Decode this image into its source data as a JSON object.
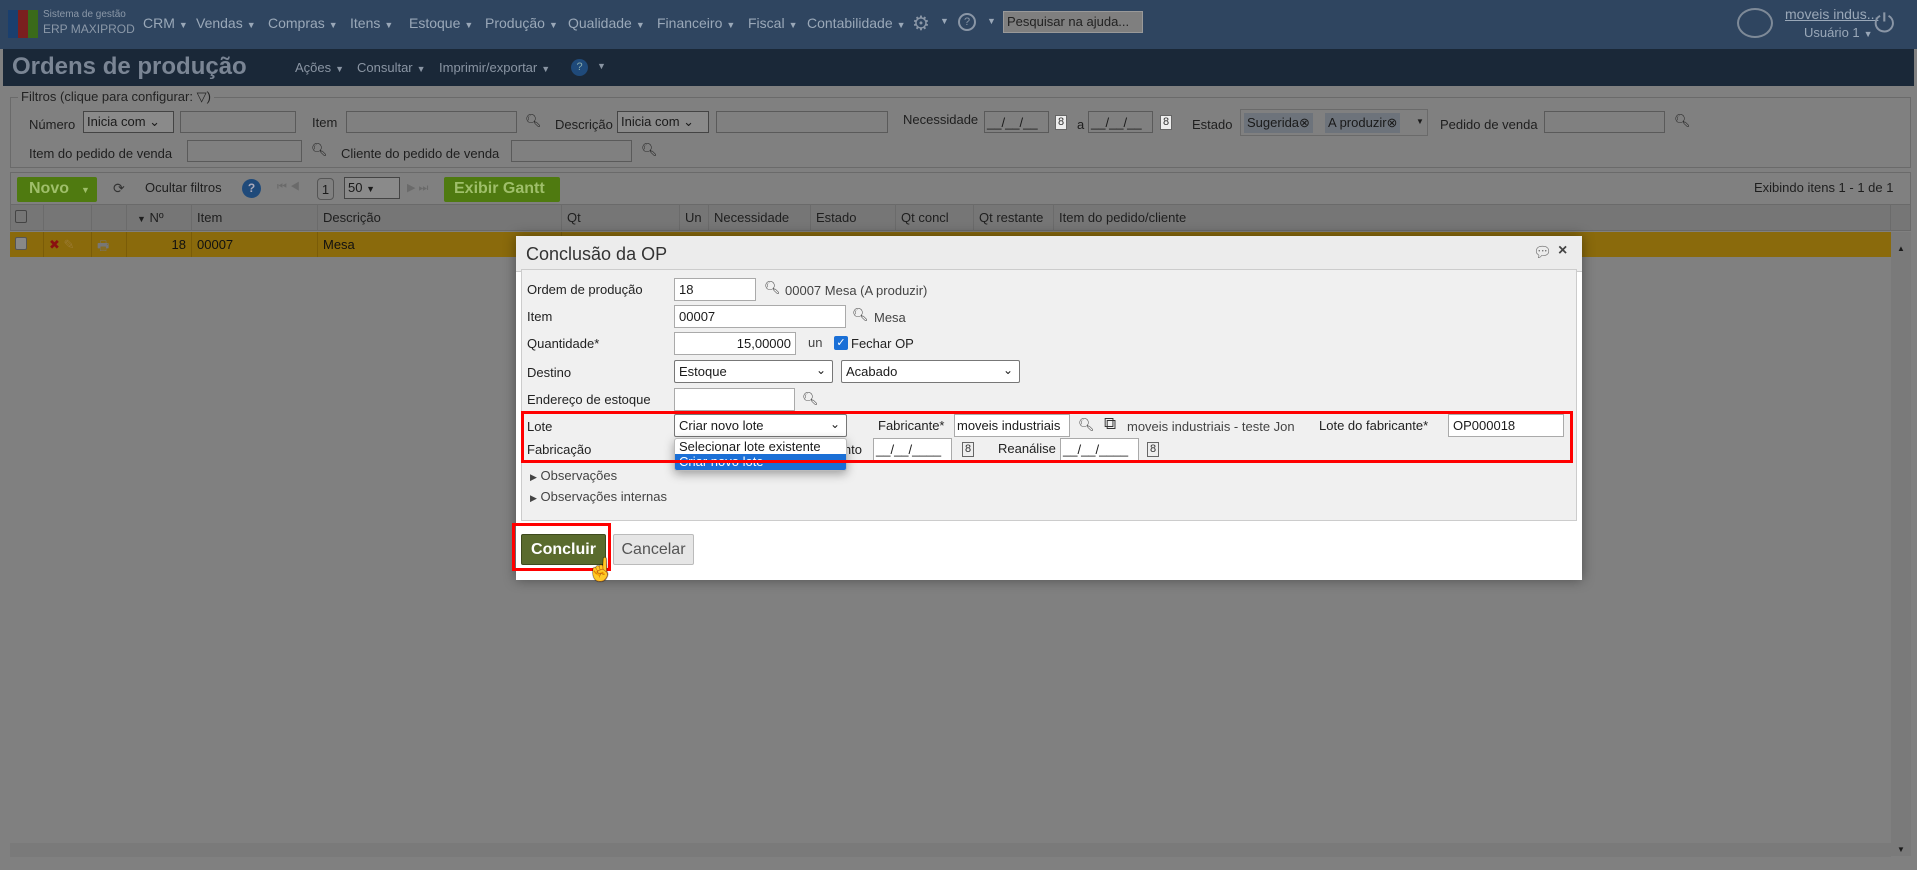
{
  "nav": {
    "logo_line1": "Sistema de gestão",
    "logo_line2": "ERP MAXIPROD",
    "menu": [
      "CRM",
      "Vendas",
      "Compras",
      "Itens",
      "Estoque",
      "Produção",
      "Qualidade",
      "Financeiro",
      "Fiscal",
      "Contabilidade"
    ],
    "search_placeholder": "Pesquisar na ajuda...",
    "company": "moveis indus...",
    "user": "Usuário 1"
  },
  "page": {
    "title": "Ordens de produção",
    "menu": [
      "Ações",
      "Consultar",
      "Imprimir/exportar"
    ]
  },
  "filters": {
    "legend": "Filtros (clique para configurar:",
    "numero": "Número",
    "numero_op": "Inicia com",
    "item": "Item",
    "descricao": "Descrição",
    "descricao_op": "Inicia com",
    "necessidade": "Necessidade",
    "date_mask": "__/__/__",
    "a": "a",
    "estado": "Estado",
    "chips": [
      "Sugerida",
      "A produzir"
    ],
    "pedido_venda": "Pedido de venda",
    "item_pedido": "Item do pedido de venda",
    "cliente_pedido": "Cliente do pedido de venda"
  },
  "toolbar": {
    "novo": "Novo",
    "ocultar": "Ocultar filtros",
    "page": "1",
    "page_size": "50",
    "gantt": "Exibir Gantt",
    "showing": "Exibindo itens 1 - 1 de 1"
  },
  "table": {
    "columns": [
      "Nº",
      "Item",
      "Descrição",
      "Qt",
      "Un",
      "Necessidade",
      "Estado",
      "Qt concl",
      "Qt restante",
      "Item do pedido/cliente"
    ],
    "rows": [
      {
        "n": "18",
        "item": "00007",
        "desc": "Mesa"
      }
    ]
  },
  "dialog": {
    "title": "Conclusão da OP",
    "ordem_label": "Ordem de produção",
    "ordem": "18",
    "ordem_desc": "00007 Mesa (A produzir)",
    "item_label": "Item",
    "item": "00007",
    "item_desc": "Mesa",
    "qtd_label": "Quantidade*",
    "qtd": "15,00000",
    "un": "un",
    "fechar": "Fechar OP",
    "fechar_checked": true,
    "destino_label": "Destino",
    "destino1": "Estoque",
    "destino2": "Acabado",
    "endereco_label": "Endereço de estoque",
    "lote_label": "Lote",
    "lote": "Criar novo lote",
    "lote_options": [
      "Selecionar lote existente",
      "Criar novo lote"
    ],
    "fabricante_label": "Fabricante*",
    "fabricante": "moveis industriais",
    "fabricante_desc": "moveis industriais - teste Jon",
    "lote_fab_label": "Lote do fabricante*",
    "lote_fab": "OP000018",
    "fabricacao_label": "Fabricação",
    "vencimento_label": "Vencimento",
    "reanalise_label": "Reanálise",
    "date_mask": "__/__/____",
    "obs": "Observações",
    "obs_int": "Observações internas",
    "concluir": "Concluir",
    "cancelar": "Cancelar"
  }
}
